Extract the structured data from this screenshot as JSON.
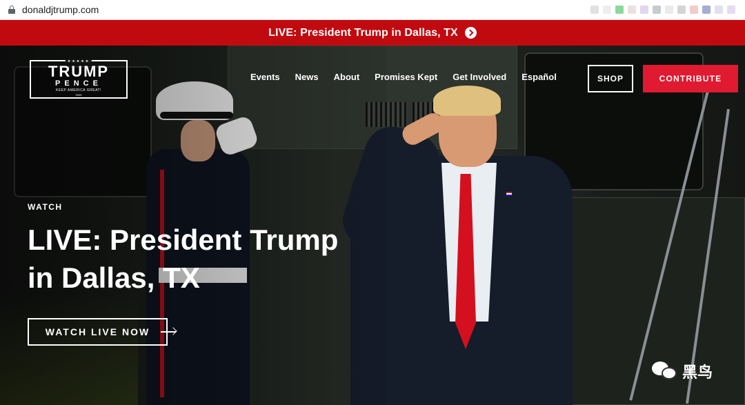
{
  "browser": {
    "url": "donaldjtrump.com",
    "lock_icon": "lock-icon",
    "extension_colors": [
      "#c8c8c8",
      "#e0e0e0",
      "#2db84d",
      "#d8c8c8",
      "#c8b4e0",
      "#9aa0a6",
      "#d8d8d8",
      "#b0b0b0",
      "#e8a0a0",
      "#5a6ab0",
      "#c8c8e0",
      "#d0c0e8"
    ]
  },
  "banner": {
    "text": "LIVE: President Trump in Dallas, TX",
    "icon": "chevron-right-circle-icon",
    "background": "#c10a10"
  },
  "logo": {
    "line1": "TRUMP",
    "line2": "PENCE",
    "tagline": "KEEP AMERICA GREAT!",
    "year": "2020",
    "stars": "★★★★★"
  },
  "nav": {
    "items": [
      "Events",
      "News",
      "About",
      "Promises Kept",
      "Get Involved",
      "Español"
    ],
    "shop": "SHOP",
    "contribute": "CONTRIBUTE",
    "contribute_color": "#e01a30"
  },
  "hero": {
    "eyebrow": "WATCH",
    "headline": "LIVE: President Trump in Dallas, TX",
    "cta": "WATCH LIVE NOW",
    "cta_icon": "arrow-right-icon"
  },
  "watermark": {
    "text": "黑鸟",
    "icon": "wechat-icon"
  }
}
